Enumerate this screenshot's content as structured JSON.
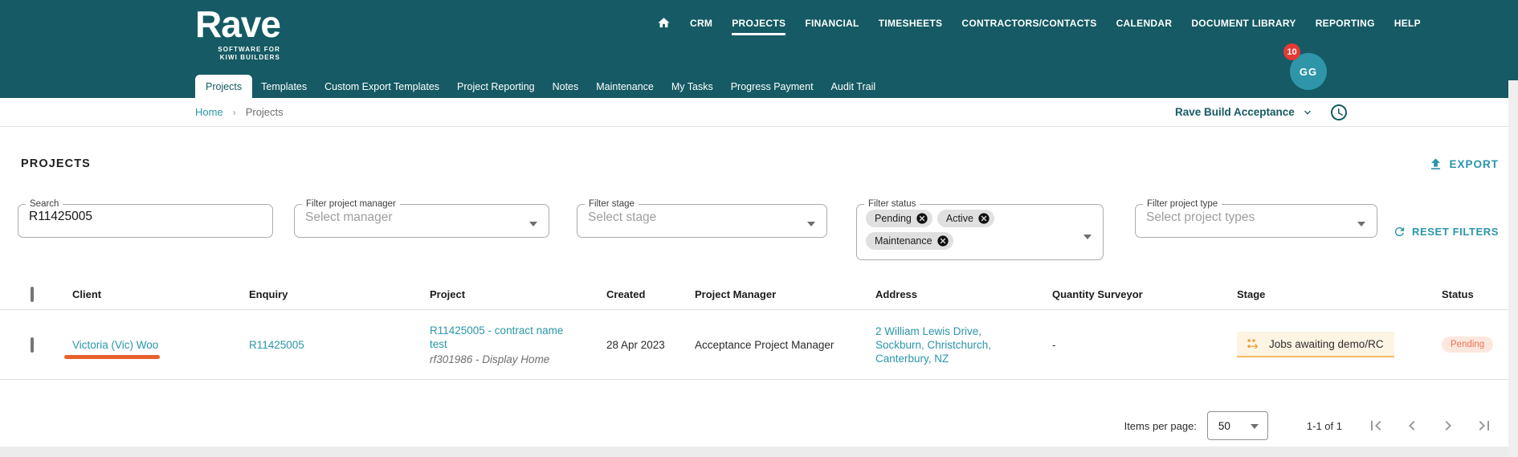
{
  "brand": {
    "name": "Rave",
    "tagline_line1": "SOFTWARE FOR",
    "tagline_line2": "KIWI BUILDERS"
  },
  "top_nav": {
    "items": [
      "CRM",
      "PROJECTS",
      "FINANCIAL",
      "TIMESHEETS",
      "CONTRACTORS/CONTACTS",
      "CALENDAR",
      "DOCUMENT LIBRARY",
      "REPORTING",
      "HELP"
    ],
    "active": "PROJECTS"
  },
  "user": {
    "initials": "GG",
    "notification_count": "10"
  },
  "sub_nav": {
    "tabs": [
      "Projects",
      "Templates",
      "Custom Export Templates",
      "Project Reporting",
      "Notes",
      "Maintenance",
      "My Tasks",
      "Progress Payment",
      "Audit Trail"
    ],
    "active": "Projects"
  },
  "breadcrumb": {
    "home": "Home",
    "current": "Projects"
  },
  "workspace": {
    "selector_label": "Rave Build Acceptance"
  },
  "page": {
    "title": "PROJECTS",
    "export_label": "EXPORT",
    "reset_filters_label": "RESET FILTERS"
  },
  "filters": {
    "search": {
      "label": "Search",
      "value": "R11425005"
    },
    "project_manager": {
      "label": "Filter project manager",
      "placeholder": "Select manager"
    },
    "stage": {
      "label": "Filter stage",
      "placeholder": "Select stage"
    },
    "status": {
      "label": "Filter status",
      "chips": [
        "Pending",
        "Active",
        "Maintenance"
      ]
    },
    "project_type": {
      "label": "Filter project type",
      "placeholder": "Select project types"
    }
  },
  "table": {
    "headers": [
      "Client",
      "Enquiry",
      "Project",
      "Created",
      "Project Manager",
      "Address",
      "Quantity Surveyor",
      "Stage",
      "Status"
    ],
    "rows": [
      {
        "client": "Victoria (Vic) Woo",
        "enquiry": "R11425005",
        "project_title": "R11425005 - contract name test",
        "project_subtitle": "rf301986 - Display Home",
        "created": "28 Apr 2023",
        "project_manager": "Acceptance Project Manager",
        "address_line1": "2 William Lewis Drive,",
        "address_line2": "Sockburn, Christchurch,",
        "address_line3": "Canterbury, NZ",
        "quantity_surveyor": "-",
        "stage": "Jobs awaiting demo/RC",
        "status": "Pending"
      }
    ]
  },
  "pagination": {
    "items_per_page_label": "Items per page:",
    "items_per_page_value": "50",
    "range_label": "1-1 of 1"
  },
  "colors": {
    "header_teal": "#155A64",
    "accent_teal": "#2A96A9",
    "annotation_orange": "#E8612C",
    "stage_chip_bg": "#FDF4E3",
    "stage_chip_border": "#F5BA66",
    "stage_icon_orange": "#F0A03C",
    "status_pending_bg": "#FCE7DE",
    "status_pending_text": "#E8764F",
    "badge_red": "#E53935",
    "avatar_teal": "#2E96A8",
    "chip_gray": "#E0E0E0"
  }
}
